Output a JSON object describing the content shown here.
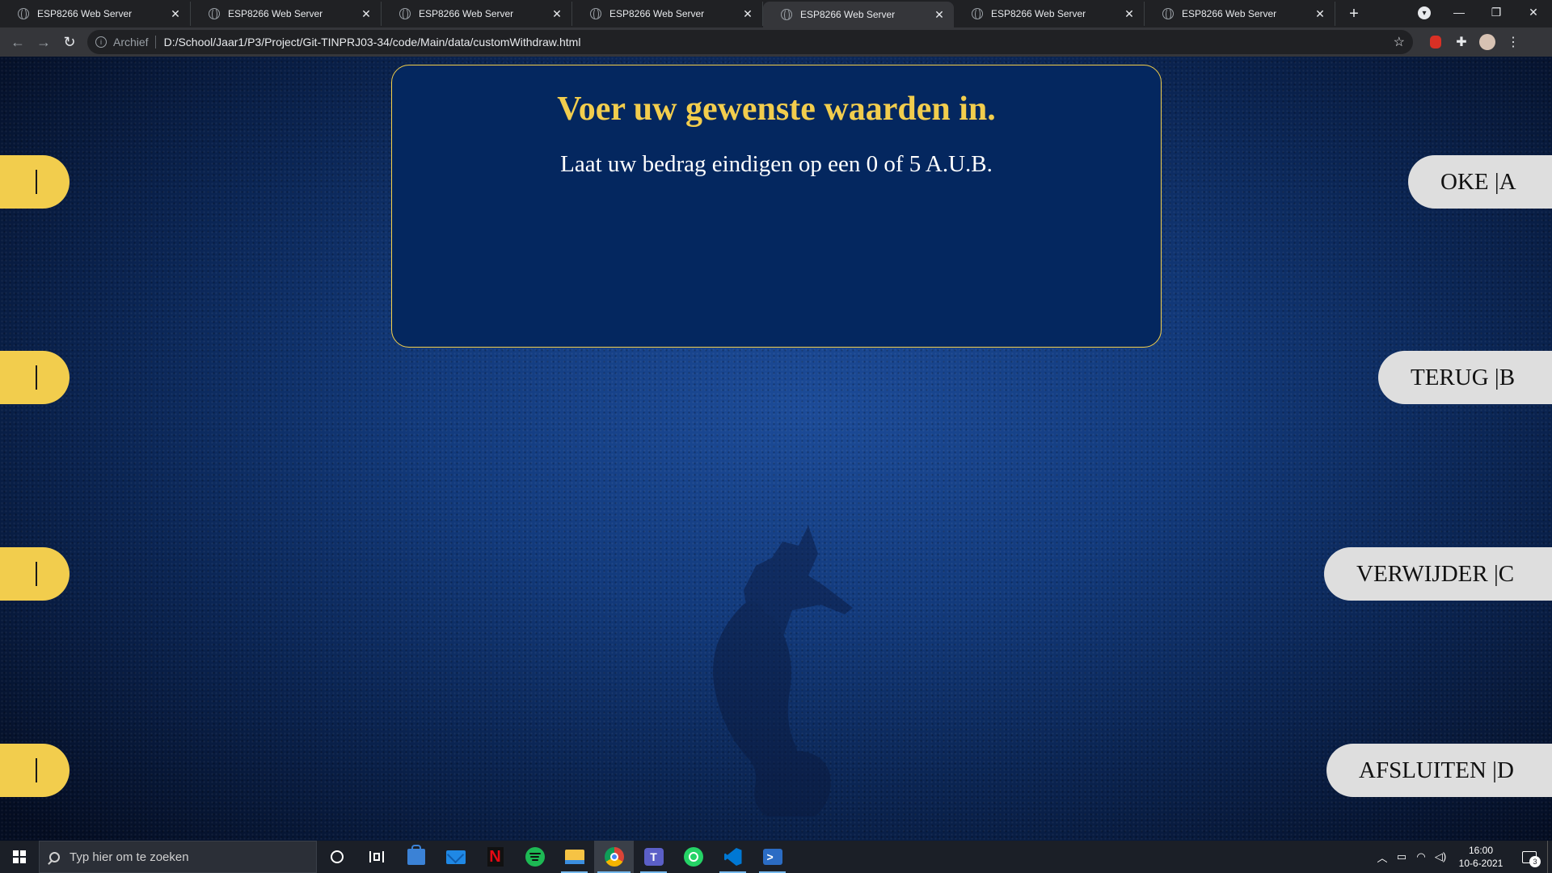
{
  "browser": {
    "tabs": [
      {
        "title": "ESP8266 Web Server",
        "active": false
      },
      {
        "title": "ESP8266 Web Server",
        "active": false
      },
      {
        "title": "ESP8266 Web Server",
        "active": false
      },
      {
        "title": "ESP8266 Web Server",
        "active": false
      },
      {
        "title": "ESP8266 Web Server",
        "active": true
      },
      {
        "title": "ESP8266 Web Server",
        "active": false
      },
      {
        "title": "ESP8266 Web Server",
        "active": false
      }
    ],
    "tab_close_glyph": "✕",
    "new_tab_glyph": "+",
    "scheme_label": "Archief",
    "url": "D:/School/Jaar1/P3/Project/Git-TINPRJ03-34/code/Main/data/customWithdraw.html",
    "window_controls": [
      "—",
      "❐",
      "✕"
    ]
  },
  "page": {
    "panel": {
      "title": "Voer uw gewenste waarden in.",
      "subtitle": "Laat uw bedrag eindigen op een 0 of 5 A.U.B."
    },
    "right_buttons": [
      {
        "label": "OKE |A"
      },
      {
        "label": "TERUG |B"
      },
      {
        "label": "VERWIJDER |C"
      },
      {
        "label": "AFSLUITEN |D"
      }
    ],
    "left_buttons_count": 4,
    "colors": {
      "panel_bg": "#04275f",
      "accent_yellow": "#f2cd4d",
      "button_grey": "#dedede"
    }
  },
  "taskbar": {
    "search_placeholder": "Typ hier om te zoeken",
    "apps": [
      "cortana-icon",
      "task-view-icon",
      "store-icon",
      "mail-icon",
      "netflix-icon",
      "spotify-icon",
      "file-explorer-icon",
      "chrome-icon",
      "teams-icon",
      "whatsapp-icon",
      "vscode-icon",
      "powershell-icon"
    ],
    "time": "16:00",
    "date": "10-6-2021",
    "notification_count": "3"
  }
}
